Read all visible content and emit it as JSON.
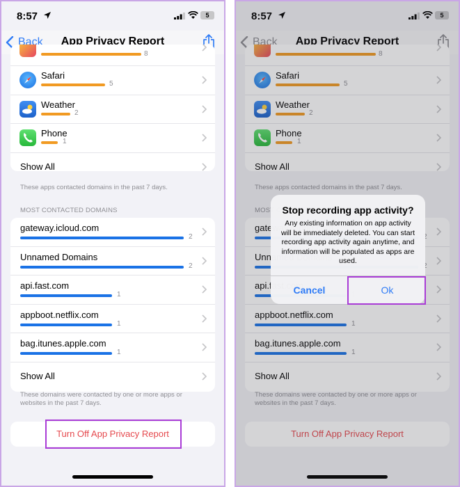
{
  "status_bar": {
    "time": "8:57",
    "battery": "5"
  },
  "nav": {
    "back_label": "Back",
    "title": "App Privacy Report"
  },
  "apps_section": {
    "partial_top_count": "8",
    "items": [
      {
        "name": "Safari",
        "count": "5",
        "value": 5
      },
      {
        "name": "Weather",
        "count": "2",
        "value": 2
      },
      {
        "name": "Phone",
        "count": "1",
        "value": 1
      }
    ],
    "show_all": "Show All",
    "footnote": "These apps contacted domains in the past 7 days."
  },
  "domains_section": {
    "header": "MOST CONTACTED DOMAINS",
    "items": [
      {
        "name": "gateway.icloud.com",
        "count": "2",
        "value": 2
      },
      {
        "name": "Unnamed Domains",
        "count": "2",
        "value": 2
      },
      {
        "name": "api.fast.com",
        "count": "1",
        "value": 1
      },
      {
        "name": "appboot.netflix.com",
        "count": "1",
        "value": 1
      },
      {
        "name": "bag.itunes.apple.com",
        "count": "1",
        "value": 1
      }
    ],
    "show_all": "Show All",
    "footnote": "These domains were contacted by one or more apps or websites in the past 7 days."
  },
  "turn_off_label": "Turn Off App Privacy Report",
  "alert": {
    "title": "Stop recording app activity?",
    "message": "Any existing information on app activity will be immediately deleted. You can start recording app activity again anytime, and information will be populated as apps are used.",
    "cancel_label": "Cancel",
    "ok_label": "Ok"
  },
  "colors": {
    "accent_blue": "#2f7cf6",
    "app_bar_orange": "#f19a22",
    "domain_bar_blue": "#1a72e6",
    "destructive_red": "#e5484d",
    "highlight_purple": "#a93bd6"
  }
}
